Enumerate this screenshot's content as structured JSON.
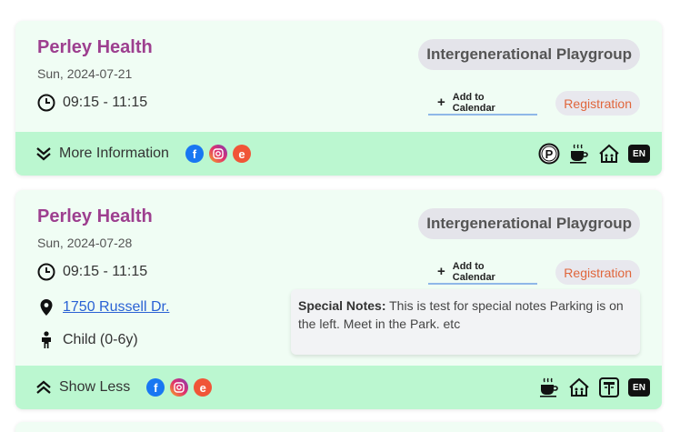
{
  "events": [
    {
      "org": "Perley Health",
      "date": "Sun, 2024-07-21",
      "time": "09:15 - 11:15",
      "tag": "Intergenerational Playgroup",
      "add_calendar": "Add to Calendar",
      "registration": "Registration",
      "footer_toggle": "More Information",
      "language_badge": "EN"
    },
    {
      "org": "Perley Health",
      "date": "Sun, 2024-07-28",
      "time": "09:15 - 11:15",
      "tag": "Intergenerational Playgroup",
      "add_calendar": "Add to Calendar",
      "registration": "Registration",
      "address": "1750 Russell Dr.",
      "age": "Child (0-6y)",
      "notes_label": "Special Notes:",
      "notes_text": "This is test for special notes Parking is on the left. Meet in the Park. etc",
      "footer_toggle": "Show Less",
      "language_badge": "EN"
    }
  ],
  "social_icons": [
    "facebook-icon",
    "instagram-icon",
    "eventbrite-icon"
  ],
  "colors": {
    "card_bg": "#f0fdf4",
    "footer_bg": "#bbf7d0",
    "org_title": "#9d3f8f",
    "registration_text": "#e0663c",
    "link": "#2a62d4"
  }
}
